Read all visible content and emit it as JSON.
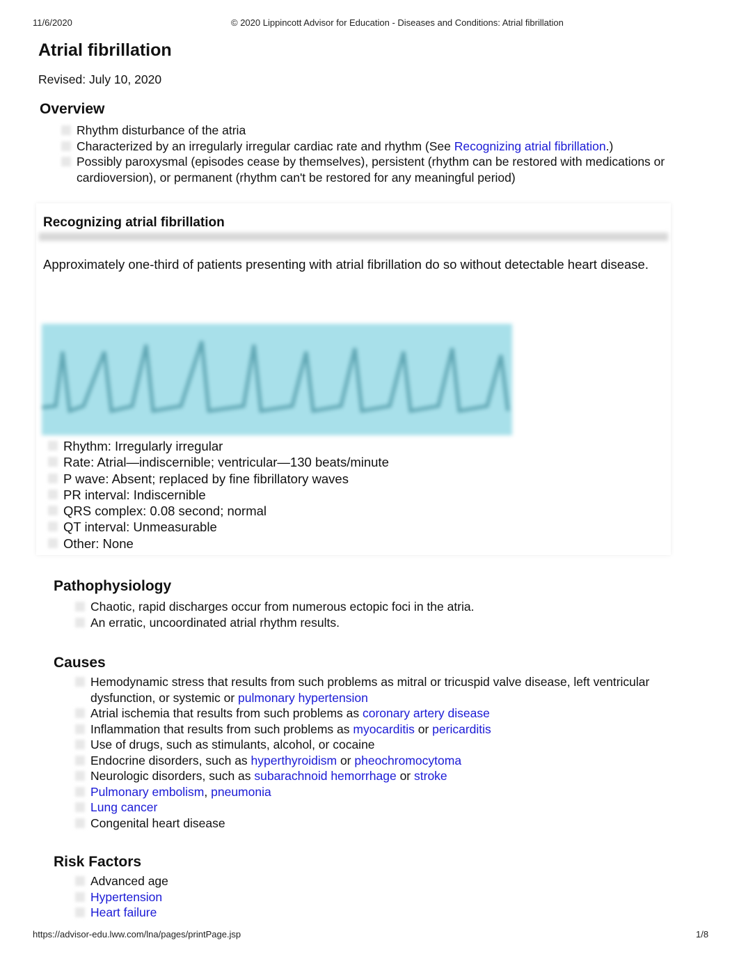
{
  "header": {
    "date": "11/6/2020",
    "title": "© 2020 Lippincott Advisor for Education - Diseases and Conditions: Atrial fibrillation"
  },
  "footer": {
    "url": "https://advisor-edu.lww.com/lna/pages/printPage.jsp",
    "page": "1/8"
  },
  "title": "Atrial fibrillation",
  "revised": "Revised: July 10, 2020",
  "overview": {
    "heading": "Overview",
    "items": [
      {
        "parts": [
          {
            "t": "Rhythm disturbance of the atria"
          }
        ]
      },
      {
        "parts": [
          {
            "t": "Characterized by an irregularly irregular cardiac rate and rhythm (See "
          },
          {
            "t": "Recognizing atrial fibrillation",
            "link": true
          },
          {
            "t": ".)"
          }
        ]
      },
      {
        "parts": [
          {
            "t": "Possibly paroxysmal (episodes cease by themselves), persistent (rhythm can be restored with medications or cardioversion), or permanent (rhythm can't be restored for any meaningful period)"
          }
        ]
      }
    ]
  },
  "recognizing": {
    "heading": "Recognizing atrial fibrillation",
    "intro": "Approximately one-third of patients presenting with atrial fibrillation do so without detectable heart disease.",
    "items": [
      "Rhythm: Irregularly irregular",
      "Rate: Atrial—indiscernible; ventricular—130 beats/minute",
      "P wave: Absent; replaced by fine fibrillatory waves",
      "PR interval: Indiscernible",
      "QRS complex: 0.08 second; normal",
      "QT interval: Unmeasurable",
      "Other: None"
    ]
  },
  "pathophysiology": {
    "heading": "Pathophysiology",
    "items": [
      {
        "parts": [
          {
            "t": "Chaotic, rapid discharges occur from numerous ectopic foci in the atria."
          }
        ]
      },
      {
        "parts": [
          {
            "t": "An erratic, uncoordinated atrial rhythm results."
          }
        ]
      }
    ]
  },
  "causes": {
    "heading": "Causes",
    "items": [
      {
        "parts": [
          {
            "t": "Hemodynamic stress that results from such problems as mitral or tricuspid valve disease, left ventricular dysfunction, or systemic or "
          },
          {
            "t": "pulmonary hypertension",
            "link": true
          }
        ]
      },
      {
        "parts": [
          {
            "t": "Atrial ischemia that results from such problems as "
          },
          {
            "t": "coronary artery disease",
            "link": true
          }
        ]
      },
      {
        "parts": [
          {
            "t": "Inflammation that results from such problems as "
          },
          {
            "t": "myocarditis",
            "link": true
          },
          {
            "t": " or "
          },
          {
            "t": "pericarditis",
            "link": true
          }
        ]
      },
      {
        "parts": [
          {
            "t": "Use of drugs, such as stimulants, alcohol, or cocaine"
          }
        ]
      },
      {
        "parts": [
          {
            "t": "Endocrine disorders, such as "
          },
          {
            "t": "hyperthyroidism",
            "link": true
          },
          {
            "t": " or "
          },
          {
            "t": "pheochromocytoma",
            "link": true
          }
        ]
      },
      {
        "parts": [
          {
            "t": "Neurologic disorders, such as "
          },
          {
            "t": "subarachnoid hemorrhage",
            "link": true
          },
          {
            "t": " or "
          },
          {
            "t": "stroke",
            "link": true
          }
        ]
      },
      {
        "parts": [
          {
            "t": "Pulmonary embolism",
            "link": true
          },
          {
            "t": ", "
          },
          {
            "t": "pneumonia",
            "link": true
          }
        ]
      },
      {
        "parts": [
          {
            "t": "Lung cancer",
            "link": true
          }
        ]
      },
      {
        "parts": [
          {
            "t": "Congenital heart disease"
          }
        ]
      }
    ]
  },
  "risk_factors": {
    "heading": "Risk Factors",
    "items": [
      {
        "parts": [
          {
            "t": "Advanced age"
          }
        ]
      },
      {
        "parts": [
          {
            "t": "Hypertension",
            "link": true
          }
        ]
      },
      {
        "parts": [
          {
            "t": "Heart failure",
            "link": true
          }
        ]
      }
    ]
  },
  "colors": {
    "link": "#1a1ad6",
    "ecg_strip": "#a8e0ea"
  }
}
